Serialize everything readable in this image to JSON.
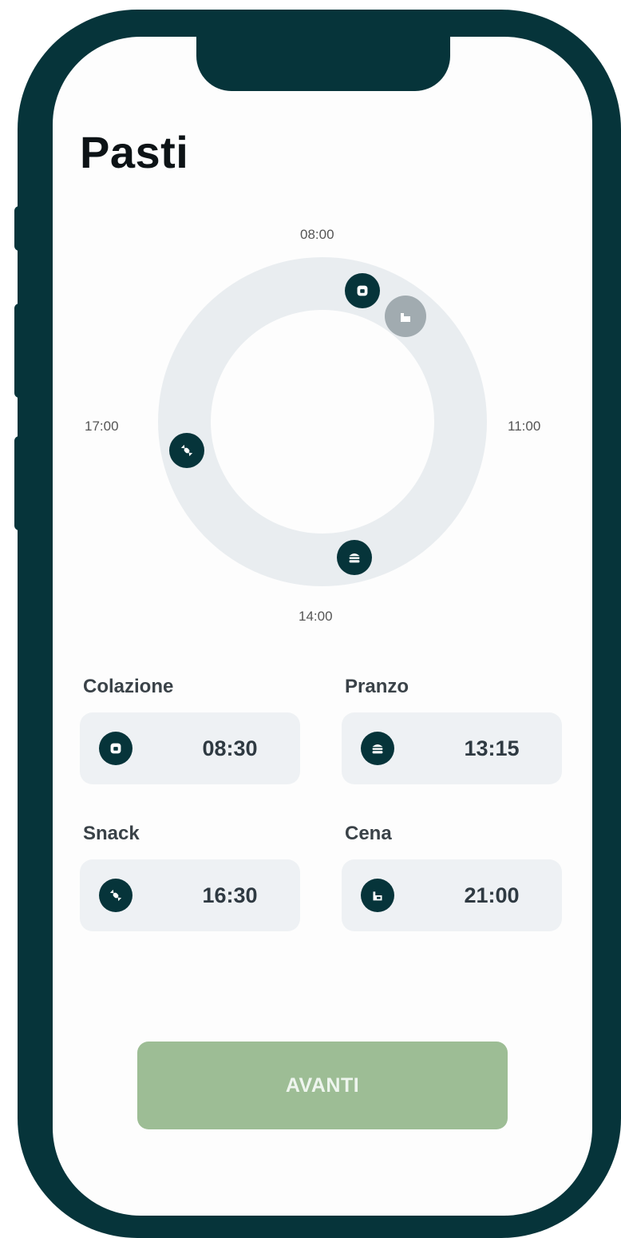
{
  "header": {
    "title": "Pasti"
  },
  "clock": {
    "ticks": {
      "top": "08:00",
      "right": "11:00",
      "bottom": "14:00",
      "left": "17:00"
    }
  },
  "meals": [
    {
      "label": "Colazione",
      "time": "08:30",
      "icon": "toast-icon"
    },
    {
      "label": "Pranzo",
      "time": "13:15",
      "icon": "burger-icon"
    },
    {
      "label": "Snack",
      "time": "16:30",
      "icon": "candy-icon"
    },
    {
      "label": "Cena",
      "time": "21:00",
      "icon": "dinner-icon"
    }
  ],
  "actions": {
    "next_label": "AVANTI"
  },
  "colors": {
    "frame": "#06343a",
    "accent_disabled": "#9dbd95",
    "ring": "#e9edf0"
  }
}
